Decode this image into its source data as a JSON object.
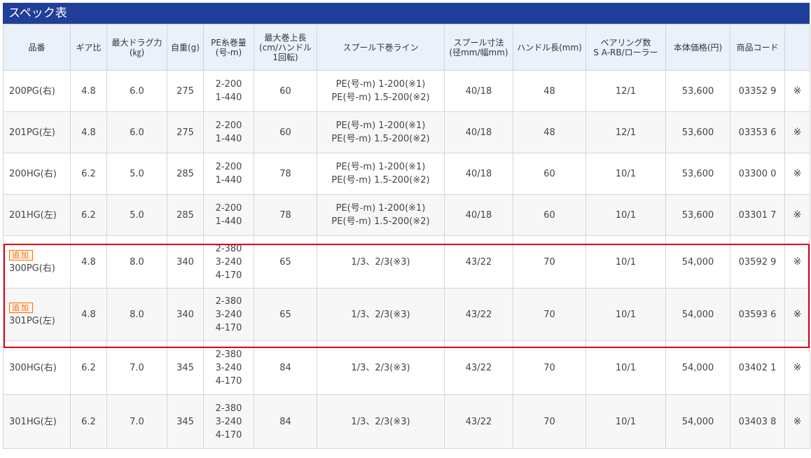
{
  "title": "スペック表",
  "headers": [
    {
      "lines": [
        "品番"
      ]
    },
    {
      "lines": [
        "ギア比"
      ]
    },
    {
      "lines": [
        "最大ドラグ力",
        "(㎏)"
      ]
    },
    {
      "lines": [
        "自重(g)"
      ]
    },
    {
      "lines": [
        "PE糸巻量",
        "(号-m)"
      ]
    },
    {
      "lines": [
        "最大巻上長",
        "(cm/ハンドル",
        "1回転)"
      ]
    },
    {
      "lines": [
        "スプール下巻ライン"
      ]
    },
    {
      "lines": [
        "スプール寸法",
        "(径mm/幅mm)"
      ]
    },
    {
      "lines": [
        "ハンドル長(mm)"
      ]
    },
    {
      "lines": [
        "ベアリング数",
        "S A-RB/ローラー"
      ]
    },
    {
      "lines": [
        "本体価格(円)"
      ]
    },
    {
      "lines": [
        "商品コード"
      ]
    },
    {
      "lines": [
        ""
      ]
    }
  ],
  "rows": [
    {
      "badge": "",
      "model": "200PG(右)",
      "gear": "4.8",
      "drag": "6.0",
      "weight": "275",
      "pe": [
        "2-200",
        "1-440"
      ],
      "retrieve": "60",
      "underline": [
        "PE(号-m) 1-200(※1)",
        "PE(号-m) 1.5-200(※2)"
      ],
      "spool": "40/18",
      "handle": "48",
      "bearing": "12/1",
      "price": "53,600",
      "code": "03352 9",
      "note": "※"
    },
    {
      "badge": "",
      "model": "201PG(左)",
      "gear": "4.8",
      "drag": "6.0",
      "weight": "275",
      "pe": [
        "2-200",
        "1-440"
      ],
      "retrieve": "60",
      "underline": [
        "PE(号-m) 1-200(※1)",
        "PE(号-m) 1.5-200(※2)"
      ],
      "spool": "40/18",
      "handle": "48",
      "bearing": "12/1",
      "price": "53,600",
      "code": "03353 6",
      "note": "※"
    },
    {
      "badge": "",
      "model": "200HG(右)",
      "gear": "6.2",
      "drag": "5.0",
      "weight": "285",
      "pe": [
        "2-200",
        "1-440"
      ],
      "retrieve": "78",
      "underline": [
        "PE(号-m) 1-200(※1)",
        "PE(号-m) 1.5-200(※2)"
      ],
      "spool": "40/18",
      "handle": "60",
      "bearing": "10/1",
      "price": "53,600",
      "code": "03300 0",
      "note": "※"
    },
    {
      "badge": "",
      "model": "201HG(左)",
      "gear": "6.2",
      "drag": "5.0",
      "weight": "285",
      "pe": [
        "2-200",
        "1-440"
      ],
      "retrieve": "78",
      "underline": [
        "PE(号-m) 1-200(※1)",
        "PE(号-m) 1.5-200(※2)"
      ],
      "spool": "40/18",
      "handle": "60",
      "bearing": "10/1",
      "price": "53,600",
      "code": "03301 7",
      "note": "※"
    },
    {
      "badge": "追加",
      "model": "300PG(右)",
      "gear": "4.8",
      "drag": "8.0",
      "weight": "340",
      "pe": [
        "2-380",
        "3-240",
        "4-170"
      ],
      "retrieve": "65",
      "underline": [
        "1/3、2/3(※3)"
      ],
      "spool": "43/22",
      "handle": "70",
      "bearing": "10/1",
      "price": "54,000",
      "code": "03592 9",
      "note": "※"
    },
    {
      "badge": "追加",
      "model": "301PG(左)",
      "gear": "4.8",
      "drag": "8.0",
      "weight": "340",
      "pe": [
        "2-380",
        "3-240",
        "4-170"
      ],
      "retrieve": "65",
      "underline": [
        "1/3、2/3(※3)"
      ],
      "spool": "43/22",
      "handle": "70",
      "bearing": "10/1",
      "price": "54,000",
      "code": "03593 6",
      "note": "※"
    },
    {
      "badge": "",
      "model": "300HG(右)",
      "gear": "6.2",
      "drag": "7.0",
      "weight": "345",
      "pe": [
        "2-380",
        "3-240",
        "4-170"
      ],
      "retrieve": "84",
      "underline": [
        "1/3、2/3(※3)"
      ],
      "spool": "43/22",
      "handle": "70",
      "bearing": "10/1",
      "price": "54,000",
      "code": "03402 1",
      "note": "※"
    },
    {
      "badge": "",
      "model": "301HG(左)",
      "gear": "6.2",
      "drag": "7.0",
      "weight": "345",
      "pe": [
        "2-380",
        "3-240",
        "4-170"
      ],
      "retrieve": "84",
      "underline": [
        "1/3、2/3(※3)"
      ],
      "spool": "43/22",
      "handle": "70",
      "bearing": "10/1",
      "price": "54,000",
      "code": "03403 8",
      "note": "※"
    }
  ],
  "colors": {
    "title_bg": "#1f3f9a",
    "header_bg": "#eaf1fb",
    "highlight_border": "#e0000f",
    "badge": "#ff6a00"
  }
}
